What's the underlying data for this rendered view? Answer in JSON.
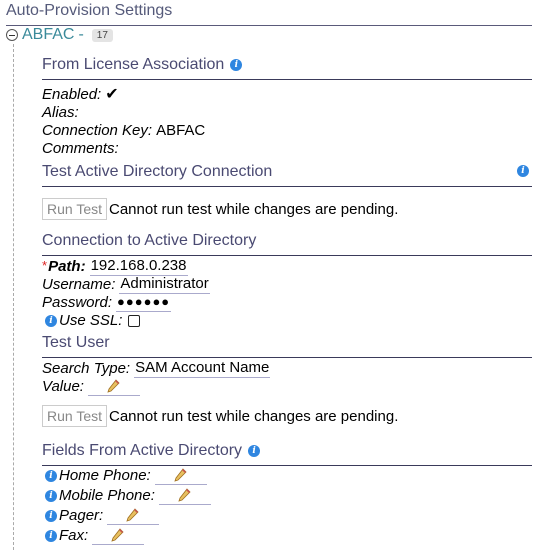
{
  "page": {
    "title": "Auto-Provision Settings"
  },
  "group": {
    "name": "ABFAC",
    "separator": "-",
    "count": "17"
  },
  "license_section": {
    "title": "From License Association",
    "fields": {
      "enabled_label": "Enabled:",
      "alias_label": "Alias:",
      "connection_key_label": "Connection Key:",
      "connection_key_value": "ABFAC",
      "comments_label": "Comments:"
    }
  },
  "test_connection_section": {
    "title": "Test Active Directory Connection",
    "button_label": "Run Test",
    "message": "Cannot run test while changes are pending."
  },
  "connection_section": {
    "title": "Connection to Active Directory",
    "path_required_mark": "*",
    "path_label": "Path:",
    "path_value": "192.168.0.238",
    "username_label": "Username:",
    "username_value": "Administrator",
    "password_label": "Password:",
    "password_value": "●●●●●●",
    "use_ssl_label": "Use SSL:"
  },
  "test_user_section": {
    "title": "Test User",
    "search_type_label": "Search Type:",
    "search_type_value": "SAM Account Name",
    "value_label": "Value:",
    "button_label": "Run Test",
    "message": "Cannot run test while changes are pending."
  },
  "fields_section": {
    "title": "Fields From Active Directory",
    "items": [
      {
        "label": "Home Phone:"
      },
      {
        "label": "Mobile Phone:"
      },
      {
        "label": "Pager:"
      },
      {
        "label": "Fax:"
      }
    ]
  },
  "icons": {
    "info": "info-icon",
    "check": "checkmark-icon",
    "edit": "pencil-icon",
    "collapse": "collapse-minus-icon"
  },
  "colors": {
    "info_blue": "#2f86e0",
    "group_teal": "#3a8a9a",
    "required_red": "#dd2222"
  }
}
